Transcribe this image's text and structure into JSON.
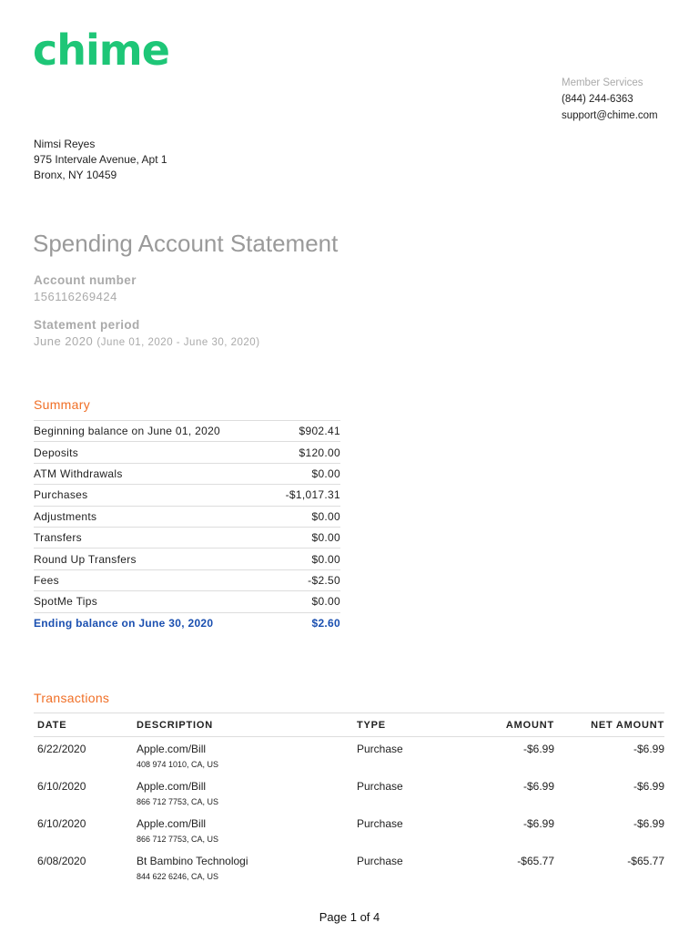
{
  "logo": "chime",
  "contact": {
    "label": "Member Services",
    "phone": "(844) 244-6363",
    "email": "support@chime.com"
  },
  "recipient": {
    "name": "Nimsi Reyes",
    "line1": "975 Intervale Avenue, Apt 1",
    "line2": "Bronx, NY 10459"
  },
  "title": "Spending Account Statement",
  "account": {
    "label": "Account number",
    "value": "156116269424"
  },
  "period": {
    "label": "Statement period",
    "value": "June 2020",
    "range": "(June 01, 2020 - June 30, 2020)"
  },
  "summary": {
    "heading": "Summary",
    "rows": [
      {
        "label": "Beginning balance on June 01, 2020",
        "value": "$902.41"
      },
      {
        "label": "Deposits",
        "value": "$120.00"
      },
      {
        "label": "ATM Withdrawals",
        "value": "$0.00"
      },
      {
        "label": "Purchases",
        "value": "-$1,017.31"
      },
      {
        "label": "Adjustments",
        "value": "$0.00"
      },
      {
        "label": "Transfers",
        "value": "$0.00"
      },
      {
        "label": "Round Up Transfers",
        "value": "$0.00"
      },
      {
        "label": "Fees",
        "value": "-$2.50"
      },
      {
        "label": "SpotMe Tips",
        "value": "$0.00"
      }
    ],
    "ending": {
      "label": "Ending balance on June 30, 2020",
      "value": "$2.60"
    }
  },
  "transactions": {
    "heading": "Transactions",
    "columns": [
      "DATE",
      "DESCRIPTION",
      "TYPE",
      "AMOUNT",
      "NET AMOUNT"
    ],
    "rows": [
      {
        "date": "6/22/2020",
        "desc": "Apple.com/Bill",
        "sub": "408 974 1010, CA, US",
        "type": "Purchase",
        "amount": "-$6.99",
        "net": "-$6.99"
      },
      {
        "date": "6/10/2020",
        "desc": "Apple.com/Bill",
        "sub": "866 712 7753, CA, US",
        "type": "Purchase",
        "amount": "-$6.99",
        "net": "-$6.99"
      },
      {
        "date": "6/10/2020",
        "desc": "Apple.com/Bill",
        "sub": "866 712 7753, CA, US",
        "type": "Purchase",
        "amount": "-$6.99",
        "net": "-$6.99"
      },
      {
        "date": "6/08/2020",
        "desc": "Bt Bambino Technologi",
        "sub": "844 622 6246, CA, US",
        "type": "Purchase",
        "amount": "-$65.77",
        "net": "-$65.77"
      }
    ]
  },
  "footer": "Page 1 of 4"
}
